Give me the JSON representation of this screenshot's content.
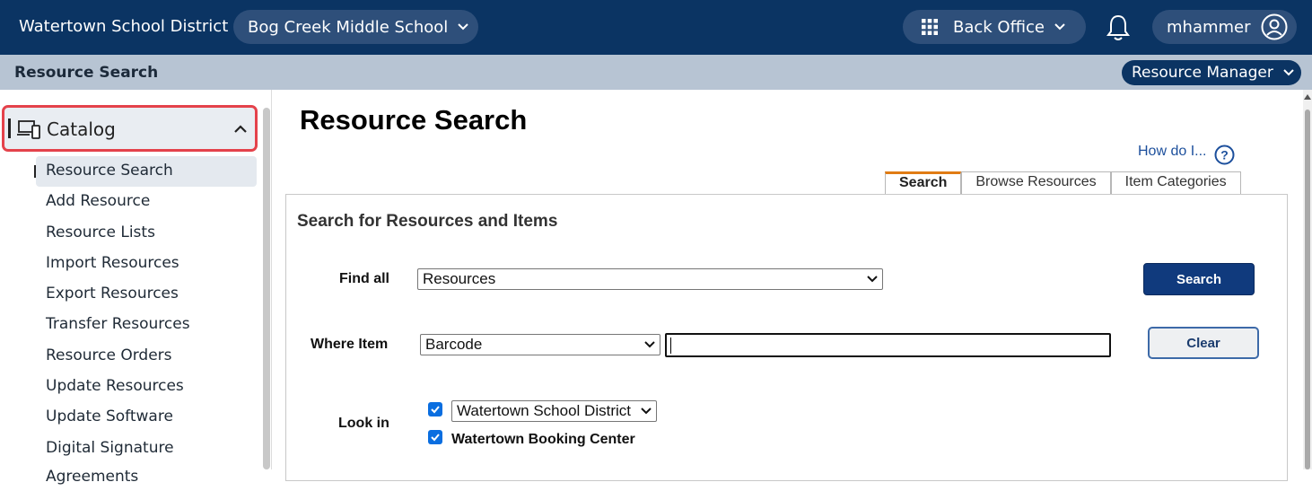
{
  "header": {
    "district": "Watertown School District",
    "school": "Bog Creek Middle School",
    "back_office": "Back Office",
    "username": "mhammer"
  },
  "subbar": {
    "title": "Resource Search",
    "manager": "Resource Manager"
  },
  "sidebar": {
    "section": "Catalog",
    "items": [
      {
        "label": "Resource Search",
        "active": true
      },
      {
        "label": "Add Resource"
      },
      {
        "label": "Resource Lists"
      },
      {
        "label": "Import Resources"
      },
      {
        "label": "Export Resources"
      },
      {
        "label": "Transfer Resources"
      },
      {
        "label": "Resource Orders"
      },
      {
        "label": "Update Resources"
      },
      {
        "label": "Update Software"
      },
      {
        "label": "Digital Signature Agreements"
      }
    ]
  },
  "main": {
    "title": "Resource Search",
    "help_link": "How do I...",
    "tabs": [
      "Search",
      "Browse Resources",
      "Item Categories"
    ],
    "active_tab": "Search",
    "panel_title": "Search for Resources and Items",
    "find_all_label": "Find all",
    "find_all_value": "Resources",
    "where_item_label": "Where Item",
    "where_item_value": "Barcode",
    "search_value": "",
    "look_in_label": "Look in",
    "look_in_district": "Watertown School District",
    "look_in_booking": "Watertown Booking Center",
    "search_button": "Search",
    "clear_button": "Clear"
  },
  "colors": {
    "header_bg": "#0b3463",
    "subbar_bg": "#b7c4d3",
    "accent_tab": "#e07b14",
    "primary_button": "#103a7d",
    "highlight_border": "#e4424b",
    "checkbox": "#0a6ee0"
  }
}
